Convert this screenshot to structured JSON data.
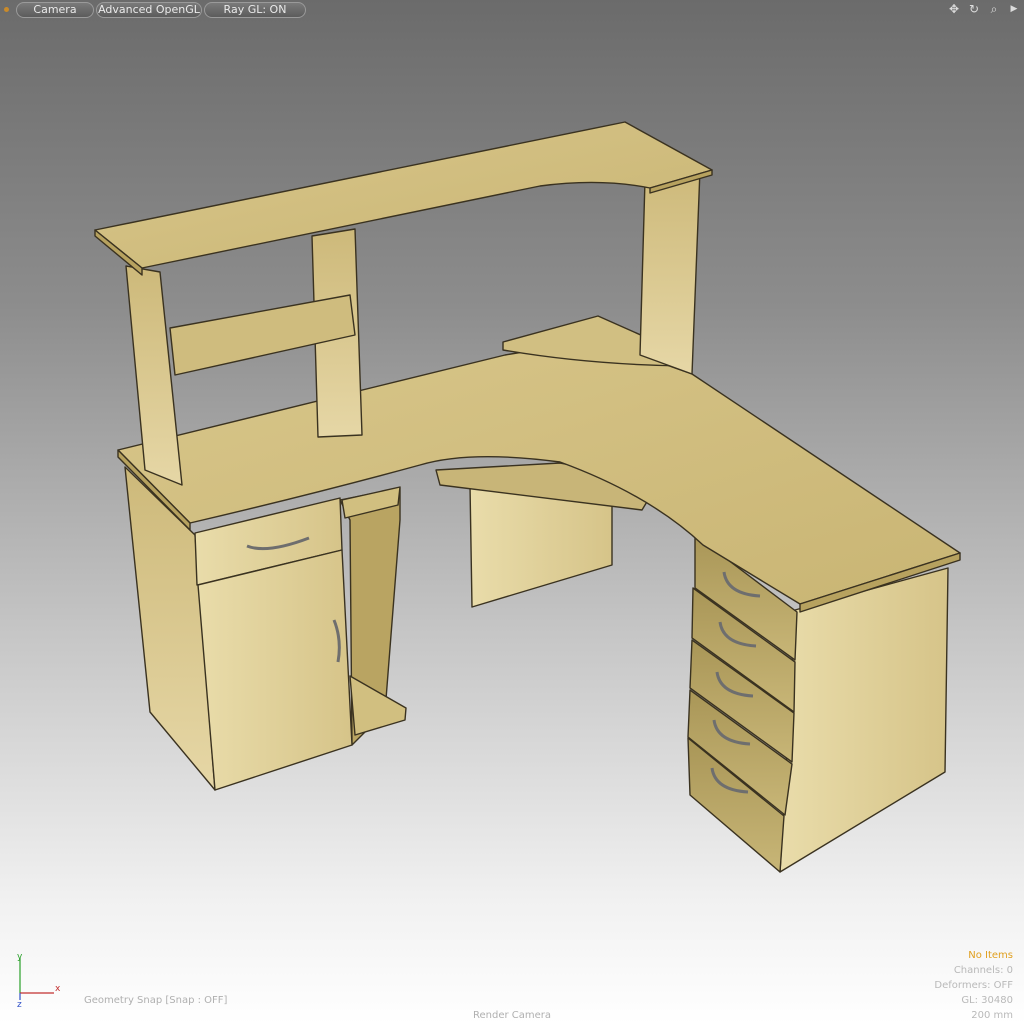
{
  "toolbar": {
    "camera_label": "Camera",
    "opengl_label": "Advanced OpenGL",
    "raygl_label": "Ray GL: ON",
    "icons": [
      "move-icon",
      "rotate-icon",
      "zoom-icon",
      "expand-arrow-icon"
    ]
  },
  "hud": {
    "snap_text": "Geometry Snap  [Snap : OFF]",
    "camera_text": "Render Camera",
    "items_text": "No Items",
    "channels_text": "Channels: 0",
    "deformers_text": "Deformers: OFF",
    "gl_text": "GL: 30480",
    "scale_text": "200 mm"
  },
  "axis": {
    "y_label": "y",
    "x_label": "x",
    "z_label": "z"
  },
  "colors": {
    "wood": "#dbc98e",
    "wood_dark": "#b8a562",
    "edge": "#3a3220",
    "items_text": "#e0a020",
    "hud_text": "#b9b9b9"
  }
}
